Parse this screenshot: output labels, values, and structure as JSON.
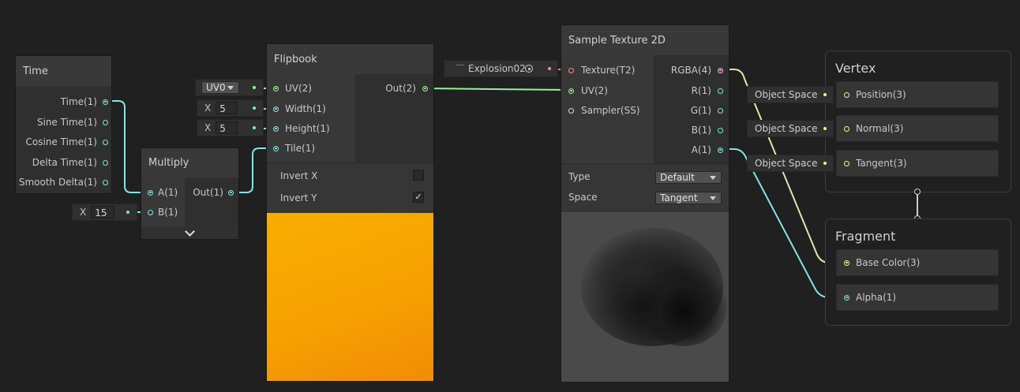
{
  "nodes": {
    "time": {
      "title": "Time",
      "outputs": [
        "Time(1)",
        "Sine Time(1)",
        "Cosine Time(1)",
        "Delta Time(1)",
        "Smooth Delta(1)"
      ]
    },
    "multiply": {
      "title": "Multiply",
      "inputs": [
        "A(1)",
        "B(1)"
      ],
      "output": "Out(1)",
      "b_field": {
        "label": "X",
        "value": "15"
      }
    },
    "flipbook": {
      "title": "Flipbook",
      "inputs": [
        "UV(2)",
        "Width(1)",
        "Height(1)",
        "Tile(1)"
      ],
      "output": "Out(2)",
      "uv_dropdown": "UV0",
      "width_field": {
        "label": "X",
        "value": "5"
      },
      "height_field": {
        "label": "X",
        "value": "5"
      },
      "invert_x": {
        "label": "Invert X",
        "checked": false
      },
      "invert_y": {
        "label": "Invert Y",
        "checked": true,
        "check_mark": "✓"
      },
      "preview_colors": [
        "#f8ae00",
        "#f28c05"
      ]
    },
    "texture_asset": {
      "label": "Explosion02"
    },
    "sample_texture": {
      "title": "Sample Texture 2D",
      "inputs": [
        "Texture(T2)",
        "UV(2)",
        "Sampler(SS)"
      ],
      "outputs": [
        "RGBA(4)",
        "R(1)",
        "G(1)",
        "B(1)",
        "A(1)"
      ],
      "type_label": "Type",
      "type_value": "Default",
      "space_label": "Space",
      "space_value": "Tangent"
    },
    "vertex": {
      "title": "Vertex",
      "ports": [
        "Position(3)",
        "Normal(3)",
        "Tangent(3)"
      ],
      "space_fields": [
        "Object Space",
        "Object Space",
        "Object Space"
      ]
    },
    "fragment": {
      "title": "Fragment",
      "ports": [
        "Base Color(3)",
        "Alpha(1)"
      ]
    }
  },
  "colors": {
    "background": "#202020",
    "float_wire": "#84e4e7",
    "vector2_wire": "#9ef09a",
    "vector4_wire": "#ffb0d6",
    "vector3_wire": "#f3f389",
    "texture_port": "#ff8a8a"
  }
}
